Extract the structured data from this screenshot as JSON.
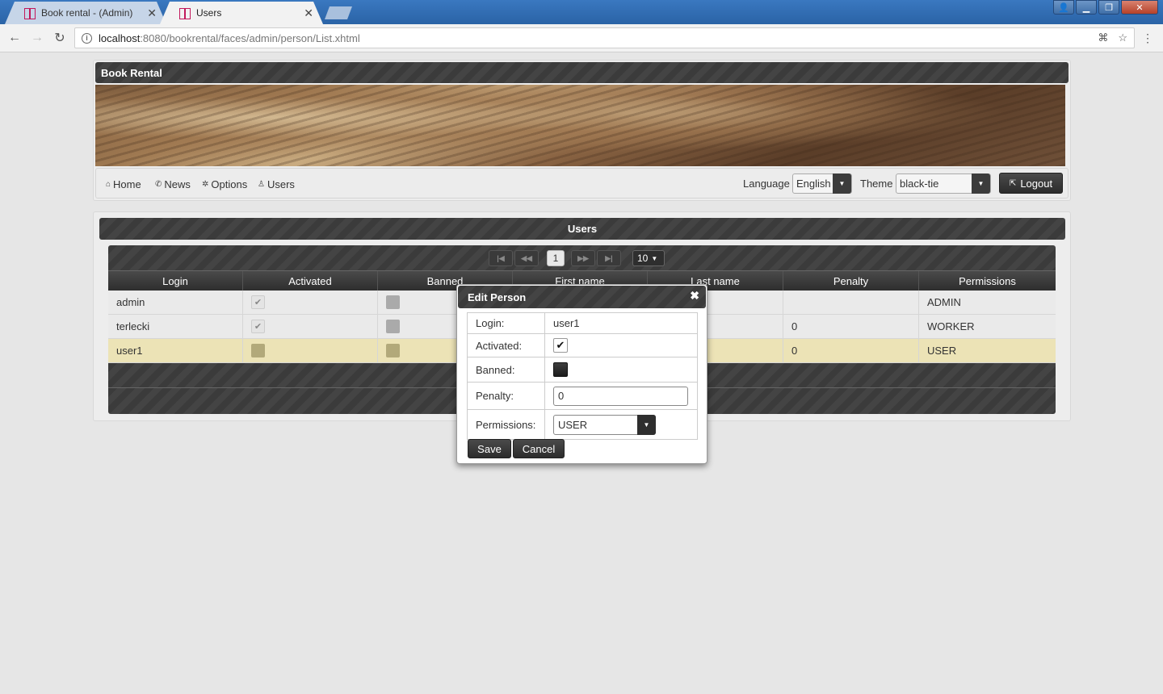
{
  "browser": {
    "tabs": [
      {
        "title": "Book rental - (Admin)"
      },
      {
        "title": "Users"
      }
    ],
    "url_host": "localhost",
    "url_path": ":8080/bookrental/faces/admin/person/List.xhtml"
  },
  "app": {
    "title": "Book Rental",
    "menu": [
      {
        "label": "Home",
        "icon": "home-icon"
      },
      {
        "label": "News",
        "icon": "news-icon"
      },
      {
        "label": "Options",
        "icon": "gear-icon"
      },
      {
        "label": "Users",
        "icon": "user-icon"
      }
    ],
    "language_label": "Language",
    "language_value": "English",
    "theme_label": "Theme",
    "theme_value": "black-tie",
    "logout_label": "Logout"
  },
  "users": {
    "title": "Users",
    "paginator": {
      "current_page": "1",
      "rows_per_page": "10"
    },
    "columns": [
      "Login",
      "Activated",
      "Banned",
      "First name",
      "Last name",
      "Penalty",
      "Permissions"
    ],
    "rows": [
      {
        "login": "admin",
        "activated": true,
        "banned": false,
        "first_name": "",
        "last_name": "",
        "penalty": "",
        "permissions": "ADMIN",
        "selected": false
      },
      {
        "login": "terlecki",
        "activated": true,
        "banned": false,
        "first_name": "",
        "last_name": "",
        "penalty": "0",
        "permissions": "WORKER",
        "selected": false
      },
      {
        "login": "user1",
        "activated": false,
        "banned": false,
        "first_name": "",
        "last_name": "",
        "penalty": "0",
        "permissions": "USER",
        "selected": true
      }
    ]
  },
  "dialog": {
    "title": "Edit Person",
    "login_label": "Login:",
    "login_value": "user1",
    "activated_label": "Activated:",
    "activated_checked": true,
    "banned_label": "Banned:",
    "banned_checked": false,
    "penalty_label": "Penalty:",
    "penalty_value": "0",
    "permissions_label": "Permissions:",
    "permissions_value": "USER",
    "save_label": "Save",
    "cancel_label": "Cancel"
  }
}
